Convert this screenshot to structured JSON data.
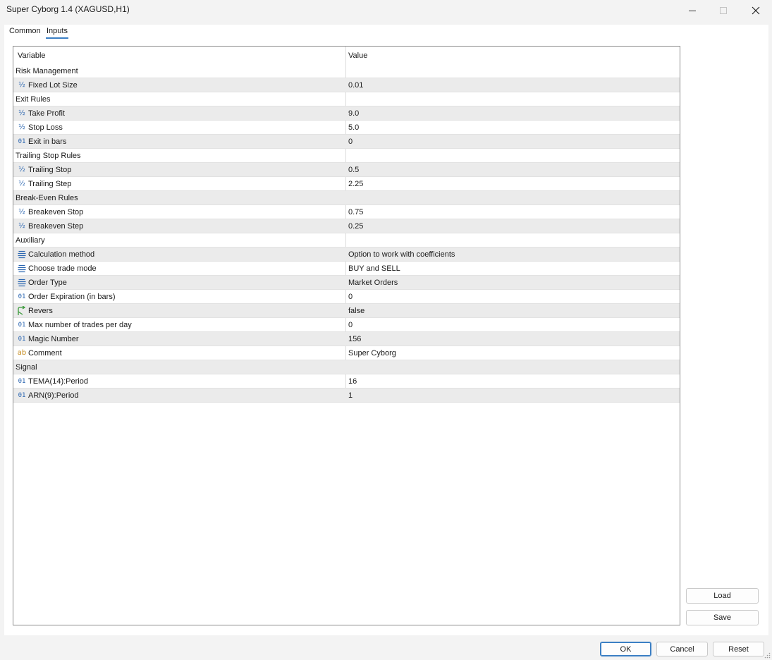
{
  "window": {
    "title": "Super Cyborg 1.4 (XAGUSD,H1)"
  },
  "tabs": [
    {
      "label": "Common",
      "active": false
    },
    {
      "label": "Inputs",
      "active": true
    }
  ],
  "grid": {
    "columns": [
      "Variable",
      "Value"
    ],
    "rows": [
      {
        "type": "group",
        "name": "Risk Management",
        "value": ""
      },
      {
        "type": "double",
        "icon": "fraction-icon",
        "name": "Fixed Lot Size",
        "value": "0.01"
      },
      {
        "type": "group",
        "name": "Exit Rules",
        "value": ""
      },
      {
        "type": "double",
        "icon": "fraction-icon",
        "name": "Take Profit",
        "value": "9.0"
      },
      {
        "type": "double",
        "icon": "fraction-icon",
        "name": "Stop Loss",
        "value": "5.0"
      },
      {
        "type": "int",
        "icon": "integer-icon",
        "name": "Exit in bars",
        "value": "0"
      },
      {
        "type": "group",
        "name": "Trailing Stop Rules",
        "value": ""
      },
      {
        "type": "double",
        "icon": "fraction-icon",
        "name": "Trailing Stop",
        "value": "0.5"
      },
      {
        "type": "double",
        "icon": "fraction-icon",
        "name": "Trailing Step",
        "value": "2.25"
      },
      {
        "type": "group",
        "name": "Break-Even Rules",
        "value": ""
      },
      {
        "type": "double",
        "icon": "fraction-icon",
        "name": "Breakeven Stop",
        "value": "0.75"
      },
      {
        "type": "double",
        "icon": "fraction-icon",
        "name": "Breakeven Step",
        "value": "0.25"
      },
      {
        "type": "group",
        "name": "Auxiliary",
        "value": ""
      },
      {
        "type": "enum",
        "icon": "enum-list-icon",
        "name": "Calculation method",
        "value": "Option to work with coefficients"
      },
      {
        "type": "enum",
        "icon": "enum-list-icon",
        "name": "Choose trade mode",
        "value": "BUY and SELL"
      },
      {
        "type": "enum",
        "icon": "enum-list-icon",
        "name": "Order Type",
        "value": "Market Orders"
      },
      {
        "type": "int",
        "icon": "integer-icon",
        "name": "Order Expiration (in bars)",
        "value": "0"
      },
      {
        "type": "bool",
        "icon": "boolean-arrow-icon",
        "name": "Revers",
        "value": "false"
      },
      {
        "type": "int",
        "icon": "integer-icon",
        "name": "Max number of trades per day",
        "value": "0"
      },
      {
        "type": "int",
        "icon": "integer-icon",
        "name": "Magic Number",
        "value": "156"
      },
      {
        "type": "string",
        "icon": "string-icon",
        "name": "Comment",
        "value": "Super Cyborg"
      },
      {
        "type": "group",
        "name": "Signal",
        "value": ""
      },
      {
        "type": "int",
        "icon": "integer-icon",
        "name": "TEMA(14):Period",
        "value": "16"
      },
      {
        "type": "int",
        "icon": "integer-icon",
        "name": "ARN(9):Period",
        "value": "1"
      }
    ]
  },
  "icon_glyphs": {
    "fraction": "½",
    "integer": "01",
    "string": "ab"
  },
  "side_buttons": {
    "load": "Load",
    "save": "Save"
  },
  "footer_buttons": {
    "ok": "OK",
    "cancel": "Cancel",
    "reset": "Reset"
  },
  "colors": {
    "accent": "#3b7fc4",
    "alt_row": "#ebebeb",
    "icon_blue": "#2b66b1",
    "icon_green": "#3a9a3a",
    "icon_orange": "#c48a1c"
  }
}
